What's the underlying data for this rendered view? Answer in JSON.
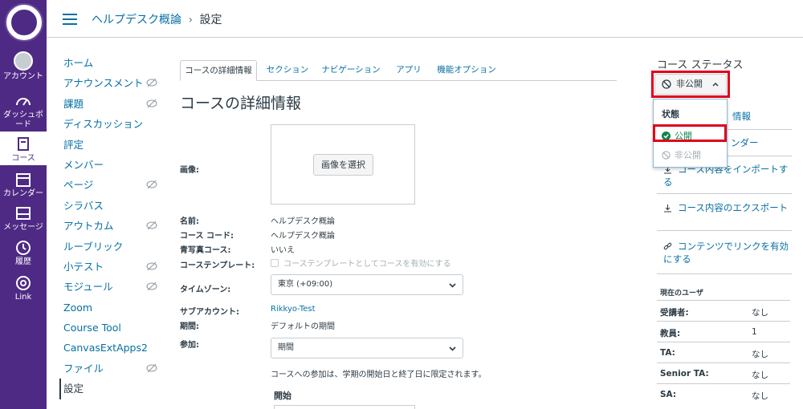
{
  "global_nav": {
    "account": "アカウント",
    "dashboard": "ダッシュボード",
    "courses": "コース",
    "calendar": "カレンダー",
    "messages": "メッセージ",
    "history": "履歴",
    "link": "Link"
  },
  "breadcrumb": {
    "course": "ヘルプデスク概論",
    "separator": "›",
    "current": "設定"
  },
  "course_nav": [
    {
      "label": "ホーム",
      "hidden": false
    },
    {
      "label": "アナウンスメント",
      "hidden": true
    },
    {
      "label": "課題",
      "hidden": true
    },
    {
      "label": "ディスカッション",
      "hidden": false
    },
    {
      "label": "評定",
      "hidden": false
    },
    {
      "label": "メンバー",
      "hidden": false
    },
    {
      "label": "ページ",
      "hidden": true
    },
    {
      "label": "シラバス",
      "hidden": false
    },
    {
      "label": "アウトカム",
      "hidden": true
    },
    {
      "label": "ルーブリック",
      "hidden": false
    },
    {
      "label": "小テスト",
      "hidden": true
    },
    {
      "label": "モジュール",
      "hidden": true
    },
    {
      "label": "Zoom",
      "hidden": false
    },
    {
      "label": "Course Tool",
      "hidden": false
    },
    {
      "label": "CanvasExtApps2",
      "hidden": false
    },
    {
      "label": "ファイル",
      "hidden": true
    },
    {
      "label": "設定",
      "hidden": false
    }
  ],
  "tabs": [
    "コースの詳細情報",
    "セクション",
    "ナビゲーション",
    "アプリ",
    "機能オプション"
  ],
  "main": {
    "title": "コースの詳細情報",
    "image_label": "画像:",
    "image_button": "画像を選択",
    "name_label": "名前:",
    "name_value": "ヘルプデスク概論",
    "code_label": "コース コード:",
    "code_value": "ヘルプデスク概論",
    "blueprint_label": "青写真コース:",
    "blueprint_value": "いいえ",
    "template_label": "コーステンプレート:",
    "template_checkbox": "コーステンプレートとしてコースを有効にする",
    "timezone_label": "タイムゾーン:",
    "timezone_value": "東京 (+09:00)",
    "subaccount_label": "サブアカウント:",
    "subaccount_value": "Rikkyo-Test",
    "term_label": "期間:",
    "term_value": "デフォルトの期間",
    "participation_label": "参加:",
    "participation_value": "期間",
    "participation_note": "コースへの参加は、学期の開始日と終了日に限定されます。",
    "start_label": "開始"
  },
  "sidebar": {
    "status_title": "コース ステータス",
    "status_button": "非公開",
    "dropdown_header": "状態",
    "option_publish": "公開",
    "option_unpublish": "非公開",
    "link_info_tail": "情報",
    "link_calendar_tail": "ンダー",
    "link_import": "コース内容をインポートする",
    "link_export": "コース内容のエクスポート",
    "link_share": "コンテンツでリンクを有効にする",
    "users_header": "現在のユーザ",
    "users": [
      {
        "role": "受講者:",
        "count": "なし"
      },
      {
        "role": "教員:",
        "count": "1"
      },
      {
        "role": "TA:",
        "count": "なし"
      },
      {
        "role": "Senior TA:",
        "count": "なし"
      },
      {
        "role": "SA:",
        "count": "なし"
      }
    ]
  },
  "colors": {
    "nav_bg": "#4e2a84",
    "link": "#0770a3",
    "highlight": "#e0001b",
    "publish_green": "#0b874b"
  }
}
